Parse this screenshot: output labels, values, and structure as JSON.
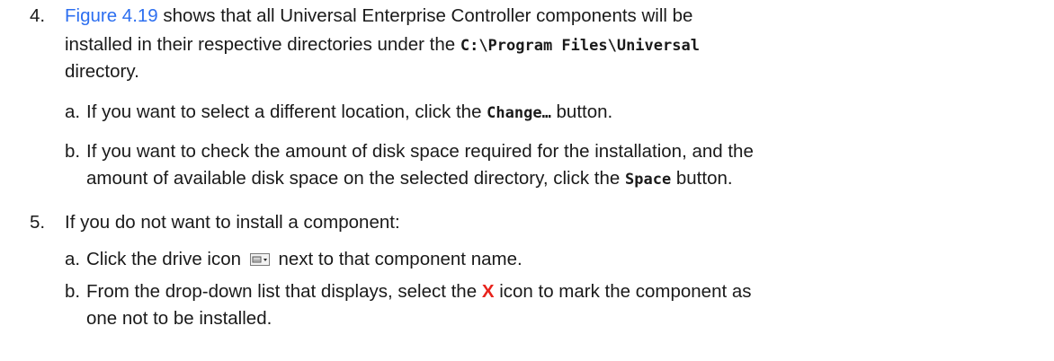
{
  "steps": [
    {
      "number": "4.",
      "link": "Figure 4.19",
      "text_a": " shows that all Universal Enterprise Controller components will be",
      "text_b": "installed in their respective directories under the ",
      "path": "C:\\Program Files\\Universal",
      "text_c": "directory.",
      "subs": [
        {
          "letter": "a.",
          "pre": "If you want to select a different location, click the ",
          "button": "Change…",
          "post": " button."
        },
        {
          "letter": "b.",
          "line1": "If you want to check the amount of disk space required for the installation, and the",
          "pre": "amount of available disk space on the selected directory, click the ",
          "button": "Space",
          "post": " button."
        }
      ]
    },
    {
      "number": "5.",
      "text": "If you do not want to install a component:",
      "subs": [
        {
          "letter": "a.",
          "pre": "Click the drive icon",
          "icon": "drive-dropdown-icon",
          "post": "next to that component name."
        },
        {
          "letter": "b.",
          "pre": "From the drop-down list that displays, select the ",
          "mark": "X",
          "post": " icon to mark the component as",
          "line2": "one not to be installed."
        }
      ]
    }
  ],
  "colors": {
    "link": "#2d6ff0",
    "x_mark": "#e8231c",
    "text": "#1a1a1a"
  }
}
